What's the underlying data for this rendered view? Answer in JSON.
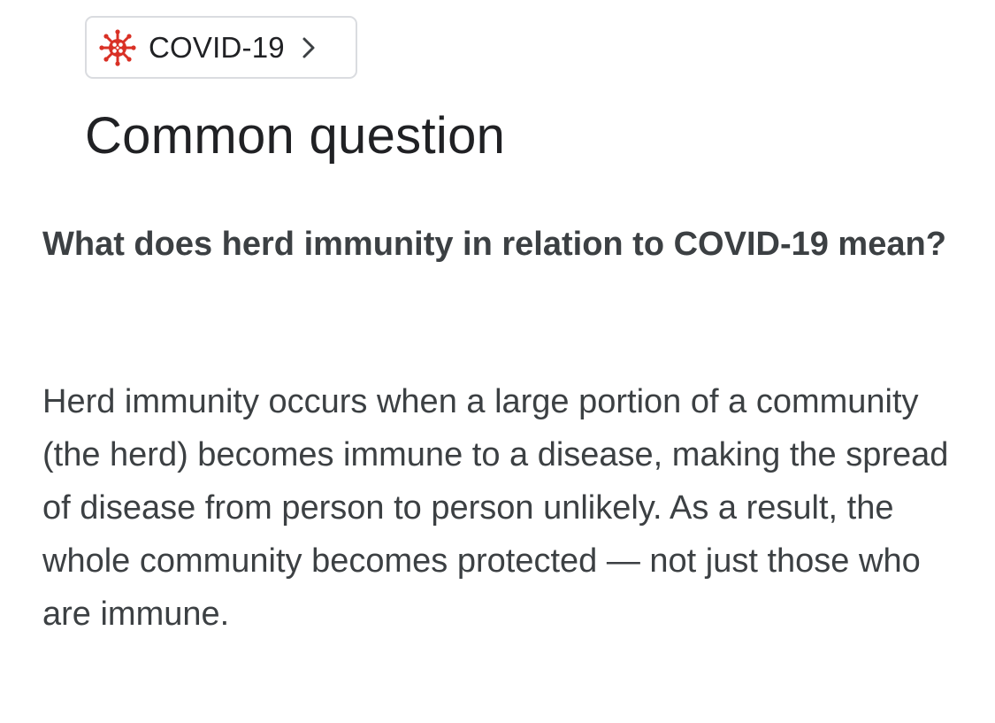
{
  "breadcrumb_chip": {
    "icon": "virus-icon",
    "label": "COVID-19",
    "chevron": "chevron-right-icon",
    "icon_color": "#d93025"
  },
  "page_title": "Common question",
  "question": "What does herd immunity in relation to COVID-19 mean?",
  "answer": "Herd immunity occurs when a large portion of a community (the herd) becomes immune to a disease, making the spread of disease from person to person unlikely. As a result, the whole community becomes protected — not just those who are immune."
}
